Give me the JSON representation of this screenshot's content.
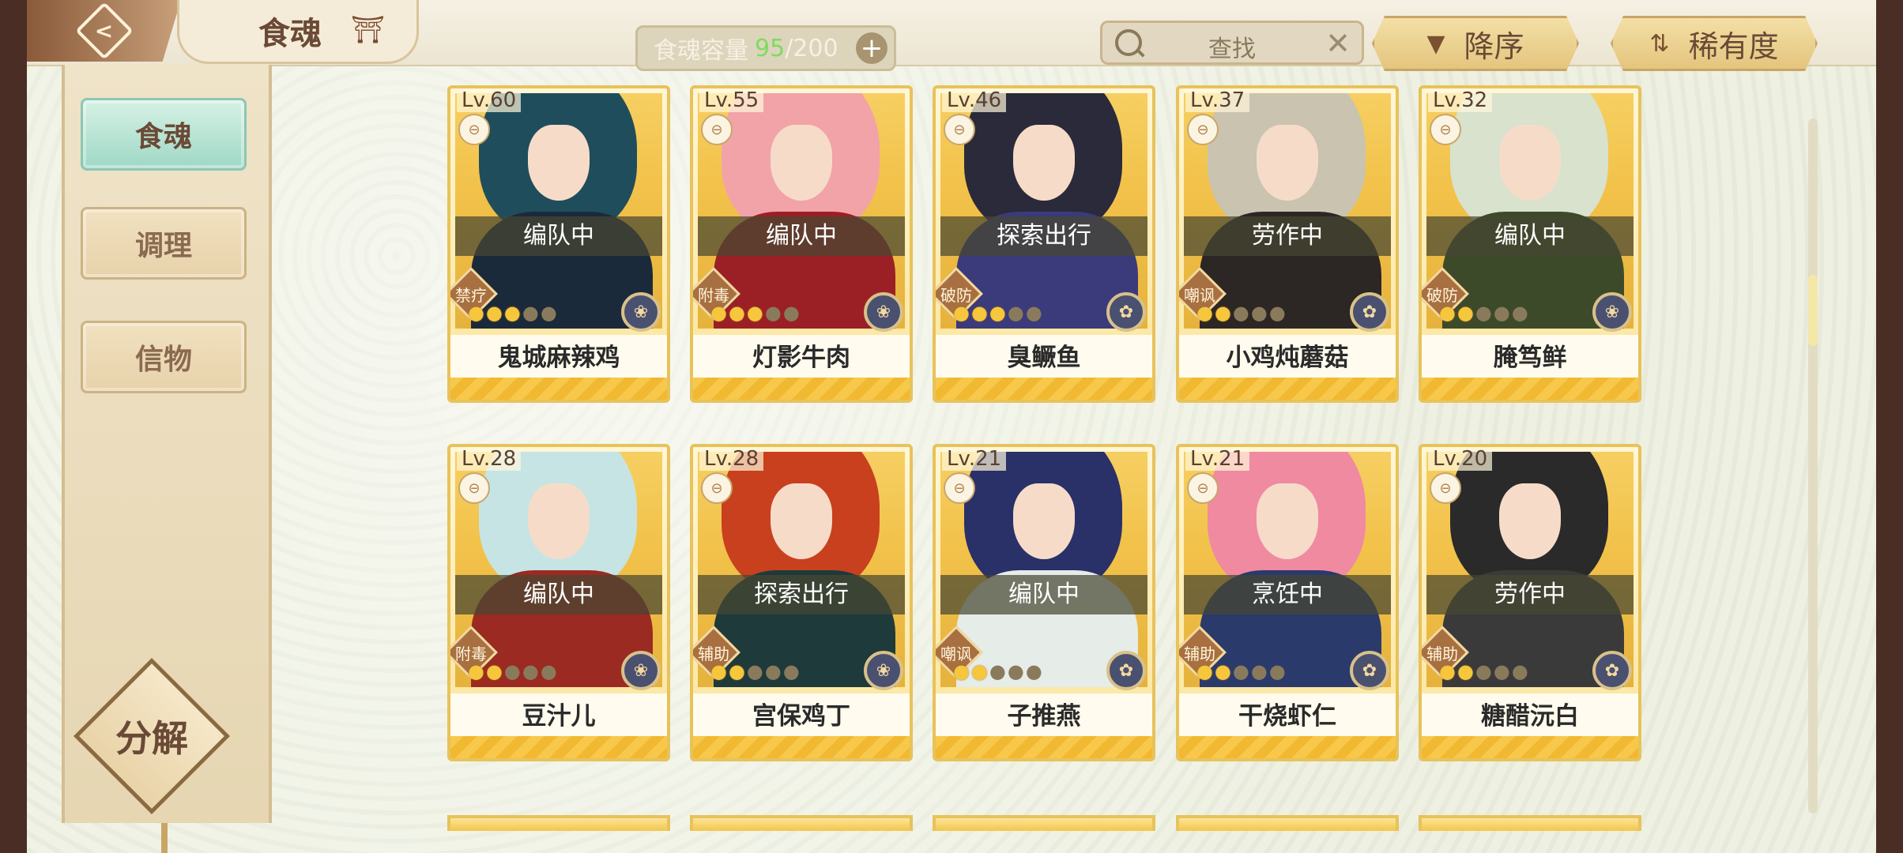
{
  "header": {
    "back_icon": "back-arrow-icon",
    "title": "食魂",
    "title_icon": "pavilion-icon",
    "capacity": {
      "label": "食魂容量",
      "current": "95",
      "separator": "/",
      "max": "200",
      "add_icon": "+"
    },
    "search": {
      "placeholder": "查找",
      "clear_icon": "✕"
    },
    "sort_order": {
      "label": "降序",
      "icon": "▼"
    },
    "sort_by": {
      "label": "稀有度",
      "icon": "⇅"
    }
  },
  "sidebar": {
    "items": [
      {
        "label": "食魂",
        "active": true
      },
      {
        "label": "调理",
        "active": false
      },
      {
        "label": "信物",
        "active": false
      }
    ],
    "decompose_label": "分解"
  },
  "list_scroll_position": 0.25,
  "cards": [
    {
      "level": "Lv.60",
      "status": "编队中",
      "role": "禁疗",
      "name": "鬼城麻辣鸡",
      "stars": 3,
      "element": "❀",
      "hair": "#1f4d5c",
      "outfit": "#1b2a3a"
    },
    {
      "level": "Lv.55",
      "status": "编队中",
      "role": "附毒",
      "name": "灯影牛肉",
      "stars": 3,
      "element": "❀",
      "hair": "#f2a3a8",
      "outfit": "#9a2026"
    },
    {
      "level": "Lv.46",
      "status": "探索出行",
      "role": "破防",
      "name": "臭鳜鱼",
      "stars": 3,
      "element": "✿",
      "hair": "#2a2a3a",
      "outfit": "#3b3a7a"
    },
    {
      "level": "Lv.37",
      "status": "劳作中",
      "role": "嘲讽",
      "name": "小鸡炖蘑菇",
      "stars": 2,
      "element": "✿",
      "hair": "#c9c3b0",
      "outfit": "#2c2624"
    },
    {
      "level": "Lv.32",
      "status": "编队中",
      "role": "破防",
      "name": "腌笃鲜",
      "stars": 2,
      "element": "❀",
      "hair": "#d8e2cc",
      "outfit": "#3d4a2a"
    },
    {
      "level": "Lv.28",
      "status": "编队中",
      "role": "附毒",
      "name": "豆汁儿",
      "stars": 2,
      "element": "❀",
      "hair": "#c6e4e4",
      "outfit": "#9a2a22"
    },
    {
      "level": "Lv.28",
      "status": "探索出行",
      "role": "辅助",
      "name": "宫保鸡丁",
      "stars": 2,
      "element": "❀",
      "hair": "#c8401e",
      "outfit": "#1e3a3a"
    },
    {
      "level": "Lv.21",
      "status": "编队中",
      "role": "嘲讽",
      "name": "子推燕",
      "stars": 2,
      "element": "✿",
      "hair": "#2a3068",
      "outfit": "#e6ece8"
    },
    {
      "level": "Lv.21",
      "status": "烹饪中",
      "role": "辅助",
      "name": "干烧虾仁",
      "stars": 2,
      "element": "✿",
      "hair": "#f08aa0",
      "outfit": "#2a3a6a"
    },
    {
      "level": "Lv.20",
      "status": "劳作中",
      "role": "辅助",
      "name": "糖醋沅白",
      "stars": 2,
      "element": "✿",
      "hair": "#2a2a2a",
      "outfit": "#3a3a3a"
    }
  ],
  "colors": {
    "accent": "#e8c25a",
    "active_tab": "#9fd8c6",
    "capacity_current": "#7ddc5e"
  }
}
